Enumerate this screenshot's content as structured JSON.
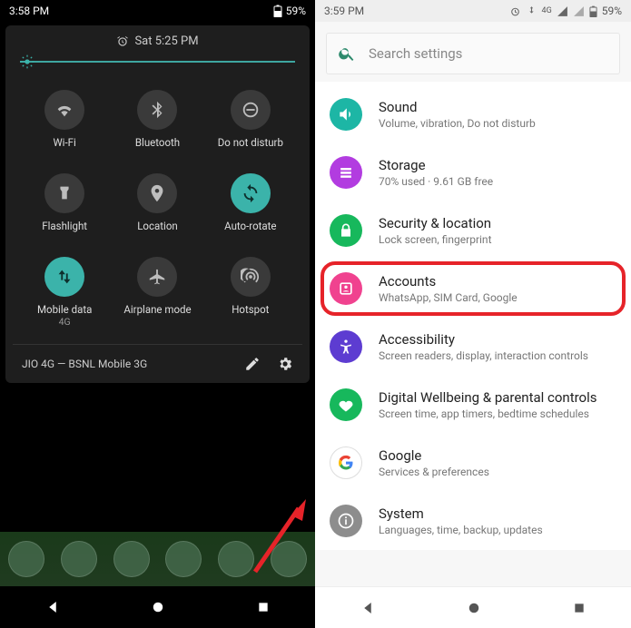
{
  "left": {
    "status": {
      "time": "3:58 PM",
      "battery": "59%"
    },
    "qs_clock_label": "Sat 5:25 PM",
    "tiles": [
      {
        "label": "Wi-Fi"
      },
      {
        "label": "Bluetooth"
      },
      {
        "label": "Do not disturb"
      },
      {
        "label": "Flashlight"
      },
      {
        "label": "Location"
      },
      {
        "label": "Auto-rotate"
      },
      {
        "label": "Mobile data",
        "sublabel": "4G"
      },
      {
        "label": "Airplane mode"
      },
      {
        "label": "Hotspot"
      }
    ],
    "footer_text": "JIO 4G — BSNL Mobile 3G"
  },
  "right": {
    "status": {
      "time": "3:59 PM",
      "battery": "59%",
      "network": "4G"
    },
    "search_placeholder": "Search settings",
    "items": [
      {
        "title": "Sound",
        "sub": "Volume, vibration, Do not disturb",
        "color": "#1db6a5"
      },
      {
        "title": "Storage",
        "sub": "70% used · 9.61 GB free",
        "color": "#b23ce0"
      },
      {
        "title": "Security & location",
        "sub": "Lock screen, fingerprint",
        "color": "#17b85c"
      },
      {
        "title": "Accounts",
        "sub": "WhatsApp, SIM Card, Google",
        "color": "#f0428f"
      },
      {
        "title": "Accessibility",
        "sub": "Screen readers, display, interaction controls",
        "color": "#5d3cd1"
      },
      {
        "title": "Digital Wellbeing & parental controls",
        "sub": "Screen time, app timers, bedtime schedules",
        "color": "#17b85c"
      },
      {
        "title": "Google",
        "sub": "Services & preferences",
        "color": "#ffffff"
      },
      {
        "title": "System",
        "sub": "Languages, time, backup, updates",
        "color": "#8d8d8d"
      }
    ]
  }
}
